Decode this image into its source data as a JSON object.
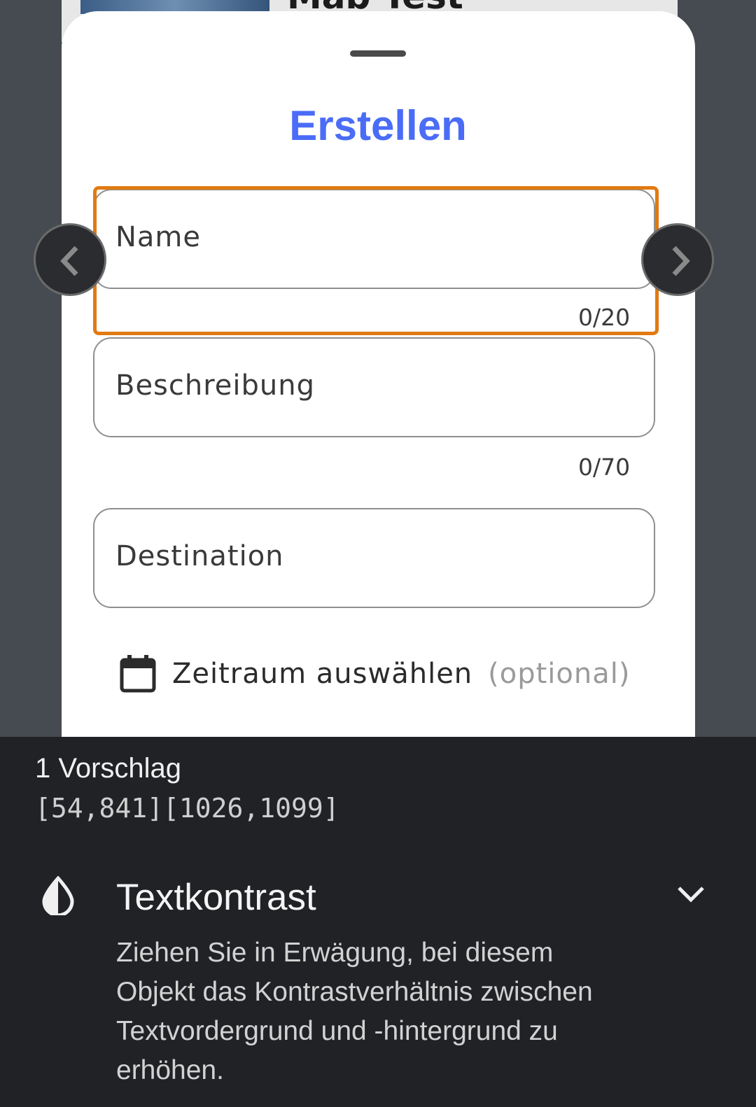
{
  "background": {
    "card_title": "Mab Test"
  },
  "sheet": {
    "title": "Erstellen",
    "fields": {
      "name": {
        "label": "Name",
        "counter": "0/20"
      },
      "description": {
        "label": "Beschreibung",
        "counter": "0/70"
      },
      "destination": {
        "label": "Destination"
      }
    },
    "date_range": {
      "label": "Zeitraum auswählen",
      "optional": "(optional)",
      "icon": "calendar-icon"
    }
  },
  "navigation": {
    "prev_icon": "chevron-left-icon",
    "next_icon": "chevron-right-icon"
  },
  "accessibility_panel": {
    "suggestion_count": "1 Vorschlag",
    "bounds": "[54,841][1026,1099]",
    "issue": {
      "icon": "contrast-drop-icon",
      "title": "Textkontrast",
      "description": "Ziehen Sie in Erwägung, bei diesem Objekt das Kontrastverhältnis zwischen Textvordergrund und -hintergrund zu erhöhen.",
      "expand_icon": "chevron-down-icon"
    }
  },
  "colors": {
    "accent": "#4a6cf7",
    "highlight": "#e07a12",
    "panel": "#202226"
  }
}
